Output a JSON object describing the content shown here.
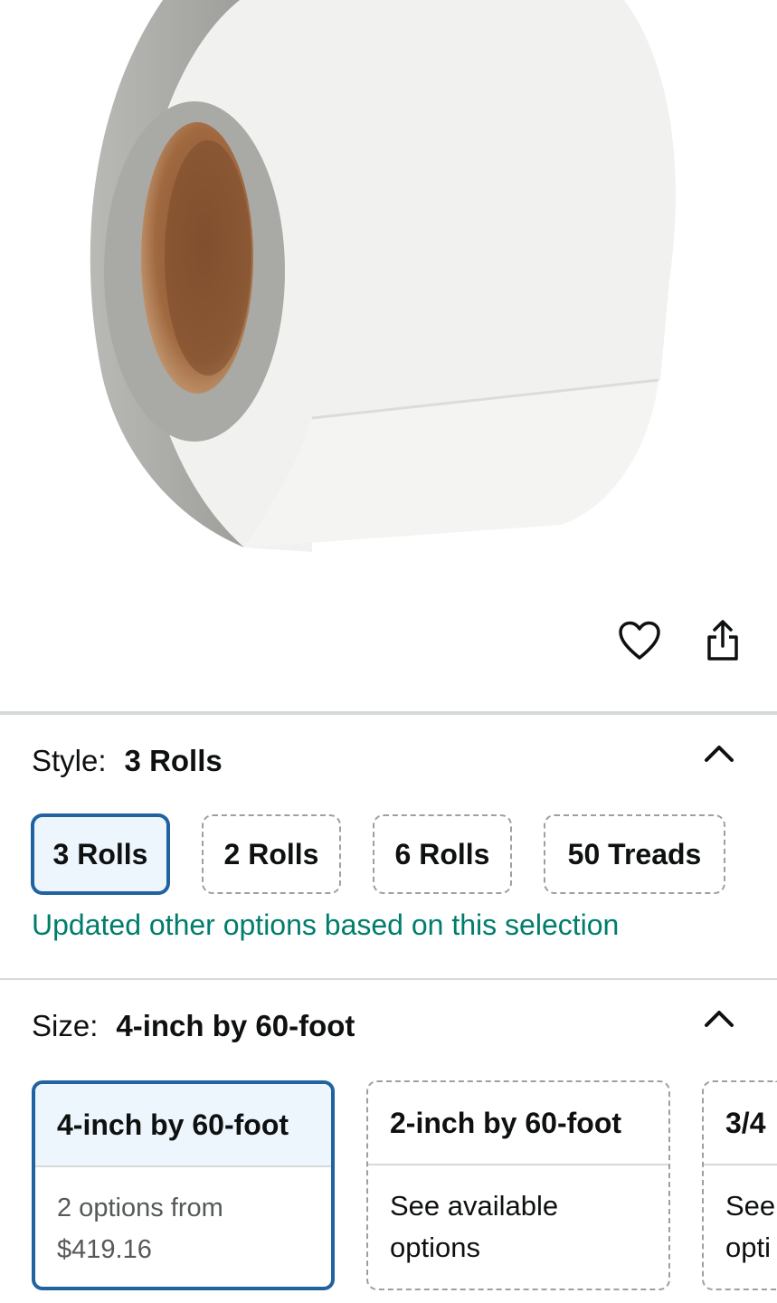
{
  "product_image": {
    "alt": "White anti-slip grip tape roll"
  },
  "actions": {
    "wishlist_icon": "heart-icon",
    "share_icon": "share-icon"
  },
  "style_section": {
    "label": "Style:",
    "selected_value": "3 Rolls",
    "options": [
      "3 Rolls",
      "2 Rolls",
      "6 Rolls",
      "50 Treads"
    ],
    "update_message": "Updated other options based on this selection"
  },
  "size_section": {
    "label": "Size:",
    "selected_value": "4-inch by 60-foot",
    "options": [
      {
        "title": "4-inch by 60-foot",
        "line1": "2 options from",
        "line2": "$419.16"
      },
      {
        "title": "2-inch by 60-foot",
        "line1": "See available",
        "line2": "options"
      },
      {
        "title": "3/4",
        "line1": "See",
        "line2": "opti"
      }
    ]
  },
  "colors": {
    "accent": "#2162a1",
    "selected_bg": "#edf6fd",
    "success": "#007d6b",
    "divider": "#d5d9d9"
  }
}
